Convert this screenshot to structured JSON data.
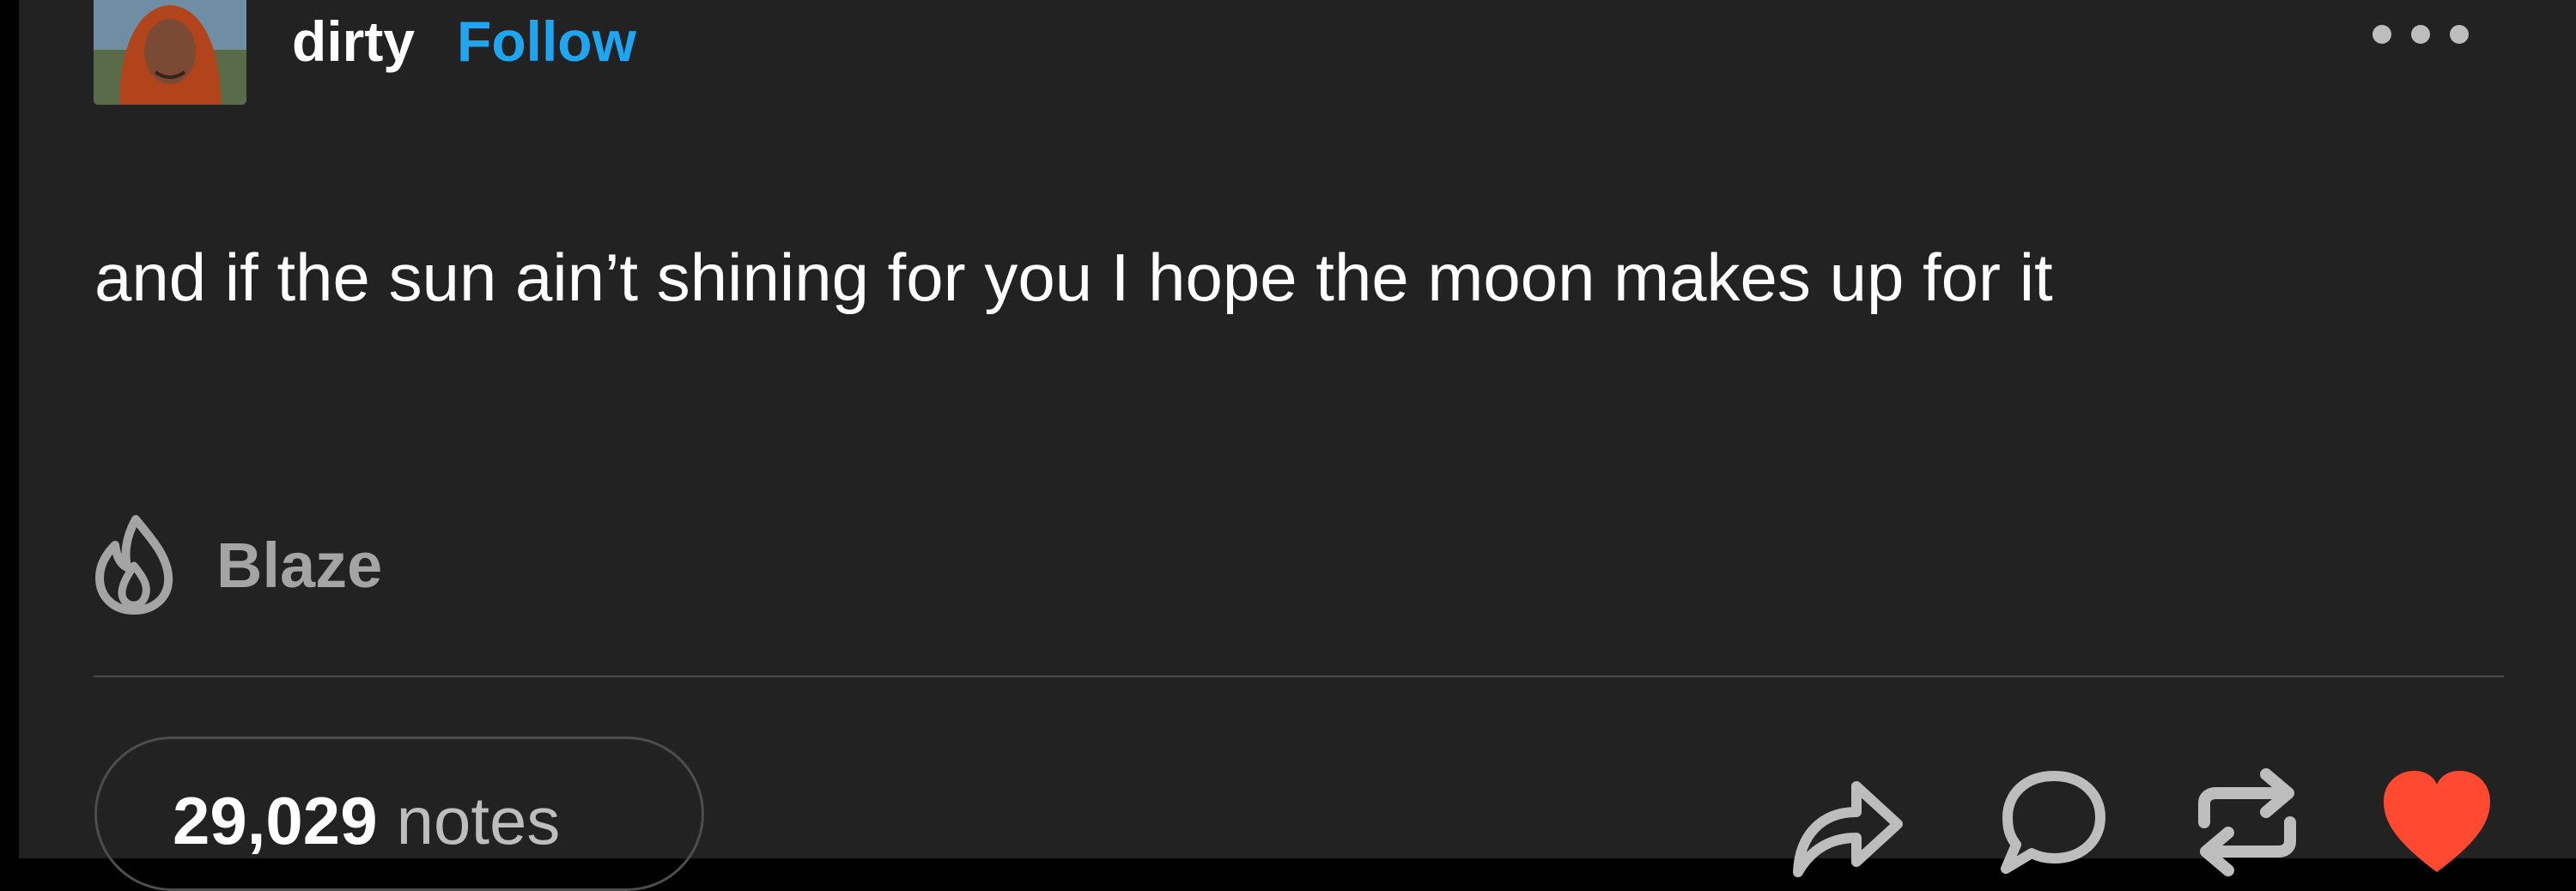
{
  "post": {
    "username": "dirty",
    "follow_label": "Follow",
    "body": "and if the sun ain’t shining for you I hope the moon makes up for it",
    "blaze_label": "Blaze",
    "notes_count": "29,029",
    "notes_label": "notes"
  },
  "icons": {
    "avatar": "avatar-image",
    "more": "more-options-icon",
    "blaze": "flame-icon",
    "share": "share-arrow-icon",
    "reply": "speech-bubble-icon",
    "reblog": "reblog-icon",
    "like": "heart-icon"
  },
  "colors": {
    "background": "#222222",
    "accent": "#1fa6f2",
    "like": "#ff4930",
    "muted": "#a4a4a4"
  }
}
